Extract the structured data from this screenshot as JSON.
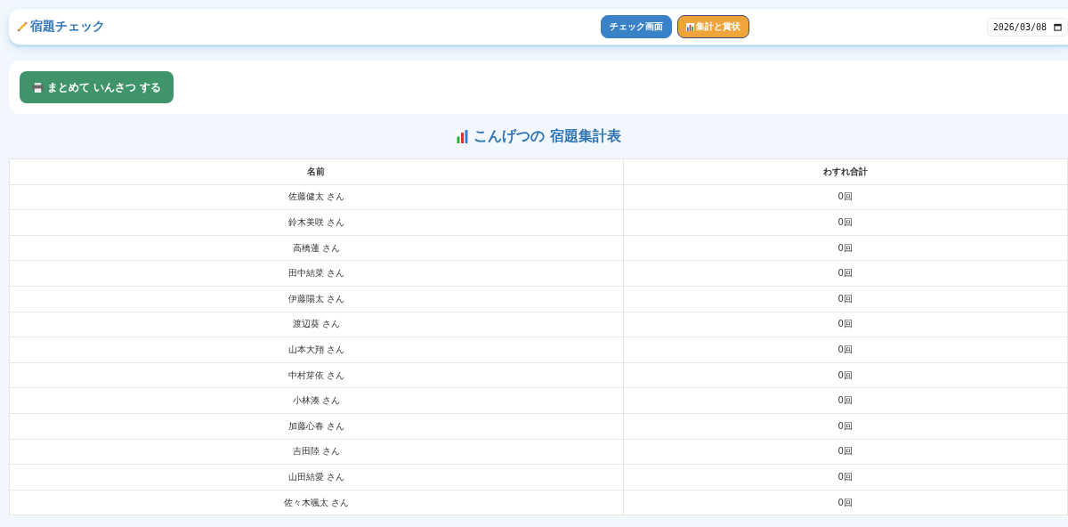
{
  "header": {
    "title": "宿題チェック",
    "nav": [
      {
        "label": "チェック画面",
        "selected": false
      },
      {
        "label": "集計と賞状",
        "selected": true
      }
    ],
    "date": "2026/03/08"
  },
  "print_button": {
    "label": "まとめて いんさつ する"
  },
  "table": {
    "title": "こんげつの 宿題集計表",
    "columns": [
      "名前",
      "わすれ合計"
    ],
    "rows": [
      [
        "佐藤健太 さん",
        "0回"
      ],
      [
        "鈴木美咲 さん",
        "0回"
      ],
      [
        "高橋蓮 さん",
        "0回"
      ],
      [
        "田中結菜 さん",
        "0回"
      ],
      [
        "伊藤陽太 さん",
        "0回"
      ],
      [
        "渡辺葵 さん",
        "0回"
      ],
      [
        "山本大翔 さん",
        "0回"
      ],
      [
        "中村芽依 さん",
        "0回"
      ],
      [
        "小林湊 さん",
        "0回"
      ],
      [
        "加藤心春 さん",
        "0回"
      ],
      [
        "吉田陸 さん",
        "0回"
      ],
      [
        "山田結愛 さん",
        "0回"
      ],
      [
        "佐々木颯太 さん",
        "0回"
      ]
    ]
  }
}
